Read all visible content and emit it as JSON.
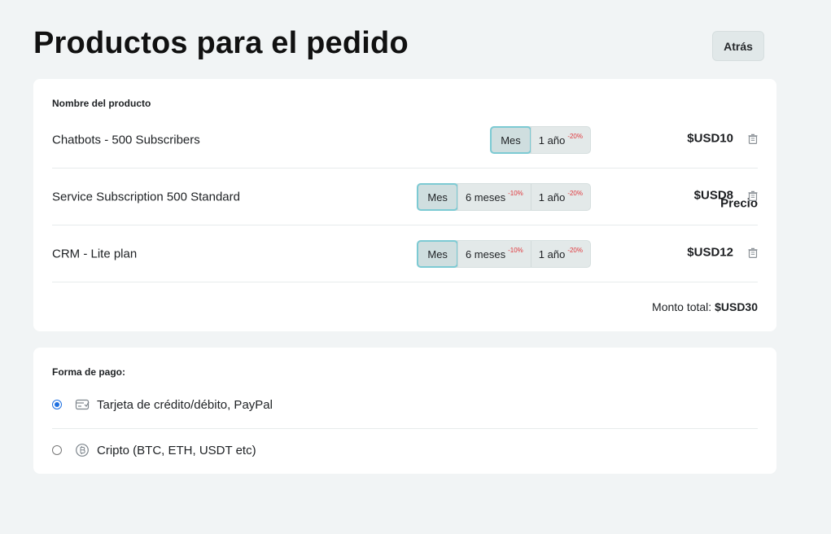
{
  "page": {
    "title": "Productos para el pedido",
    "back_label": "Atrás"
  },
  "products": {
    "header_name": "Nombre del producto",
    "header_price": "Precio",
    "rows": [
      {
        "name": "Chatbots - 500 Subscribers",
        "periods": [
          {
            "label": "Mes",
            "discount": "",
            "active": true
          },
          {
            "label": "1 año",
            "discount": "-20%",
            "active": false
          }
        ],
        "price": "$USD10"
      },
      {
        "name": "Service Subscription 500 Standard",
        "periods": [
          {
            "label": "Mes",
            "discount": "",
            "active": true
          },
          {
            "label": "6 meses",
            "discount": "-10%",
            "active": false
          },
          {
            "label": "1 año",
            "discount": "-20%",
            "active": false
          }
        ],
        "price": "$USD8"
      },
      {
        "name": "CRM - Lite plan",
        "periods": [
          {
            "label": "Mes",
            "discount": "",
            "active": true
          },
          {
            "label": "6 meses",
            "discount": "-10%",
            "active": false
          },
          {
            "label": "1 año",
            "discount": "-20%",
            "active": false
          }
        ],
        "price": "$USD12"
      }
    ],
    "total_label": "Monto total:",
    "total_value": "$USD30"
  },
  "payment": {
    "header": "Forma de pago:",
    "options": [
      {
        "label": "Tarjeta de crédito/débito, PayPal",
        "icon": "card-icon",
        "selected": true
      },
      {
        "label": "Cripto (BTC, ETH, USDT etc)",
        "icon": "crypto-coin-icon",
        "selected": false
      }
    ]
  },
  "colors": {
    "background": "#f1f4f5",
    "card": "#ffffff",
    "active_border": "#7ccad3",
    "discount": "#e0393e",
    "radio_selected": "#1e6fe0"
  }
}
